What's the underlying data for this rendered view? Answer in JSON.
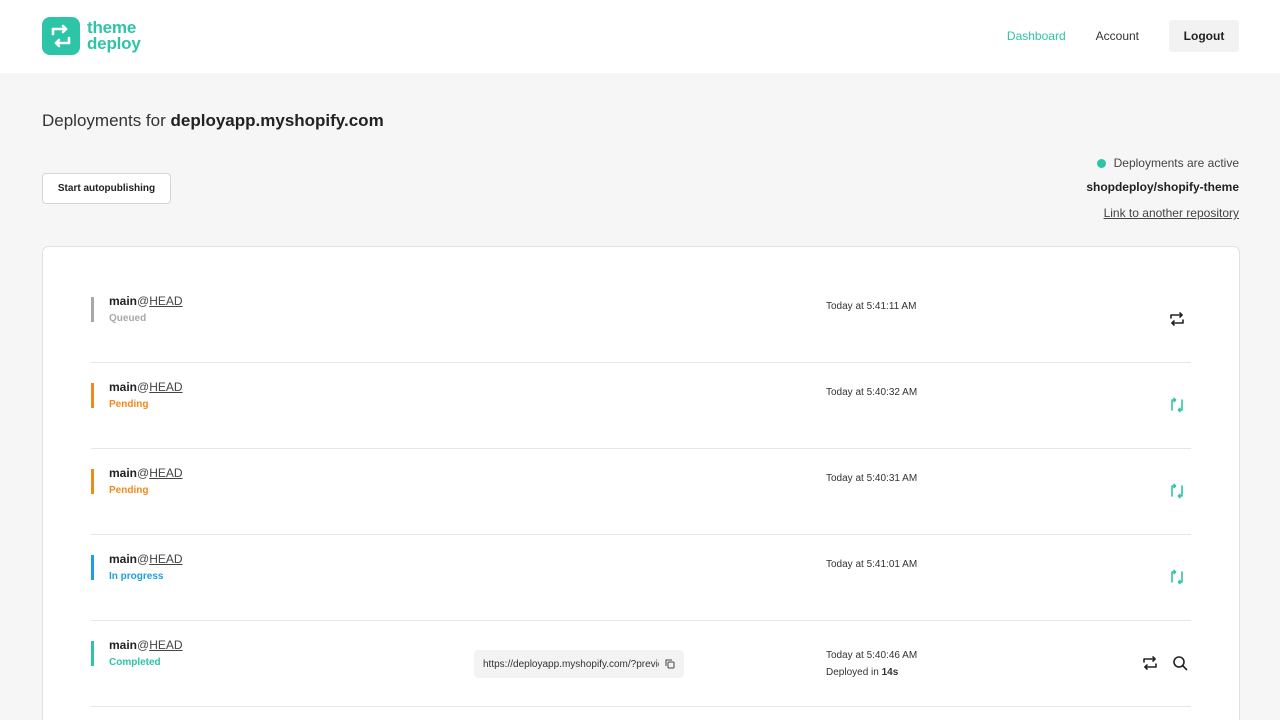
{
  "brand": {
    "line1": "theme",
    "line2": "deploy",
    "color": "#2ec4a8"
  },
  "nav": {
    "dashboard": "Dashboard",
    "account": "Account",
    "logout": "Logout"
  },
  "page": {
    "title_prefix": "Deployments for",
    "store": "deployapp.myshopify.com"
  },
  "actions": {
    "start_autopublishing": "Start autopublishing"
  },
  "status": {
    "active_text": "Deployments are active",
    "repo": "shopdeploy/shopify-theme",
    "link_repo": "Link to another repository"
  },
  "status_colors": {
    "queued": "#a8a8a8",
    "pending": "#f08a1c",
    "in_progress": "#1e9fe0",
    "completed": "#2ec4a8"
  },
  "deployments": [
    {
      "branch": "main",
      "at": "@",
      "ref": "HEAD",
      "status": "Queued",
      "time": "Today at 5:41:11 AM",
      "action_icon": "redeploy-icon"
    },
    {
      "branch": "main",
      "at": "@",
      "ref": "HEAD",
      "status": "Pending",
      "time": "Today at 5:40:32 AM",
      "action_icon": "sync-icon"
    },
    {
      "branch": "main",
      "at": "@",
      "ref": "HEAD",
      "status": "Pending",
      "time": "Today at 5:40:31 AM",
      "action_icon": "sync-icon"
    },
    {
      "branch": "main",
      "at": "@",
      "ref": "HEAD",
      "status": "In progress",
      "time": "Today at 5:41:01 AM",
      "action_icon": "sync-icon"
    },
    {
      "branch": "main",
      "at": "@",
      "ref": "HEAD",
      "status": "Completed",
      "time": "Today at 5:40:46 AM",
      "preview_url": "https://deployapp.myshopify.com/?preview_theme_id=",
      "duration_prefix": "Deployed in",
      "duration": "14s",
      "action_icon": "redeploy-icon",
      "secondary_icon": "search-icon"
    }
  ]
}
